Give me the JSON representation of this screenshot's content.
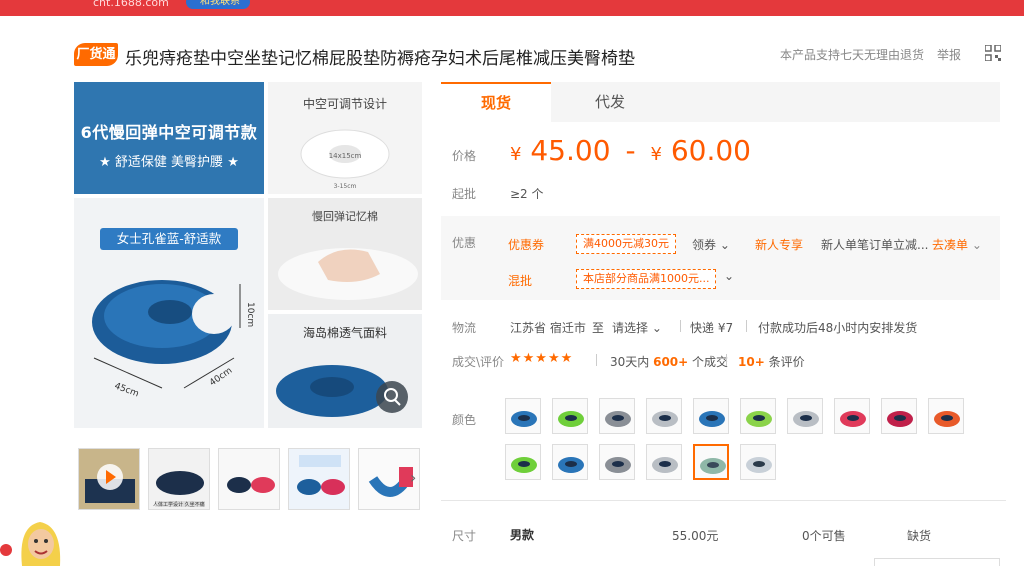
{
  "topbar": {
    "site": "cht.1688.com",
    "tag": "和我联系"
  },
  "header": {
    "badge": "厂货通",
    "title": "乐兜痔疮垫中空坐垫记忆棉屁股垫防褥疮孕妇术后尾椎减压美臀椅垫",
    "policy": "本产品支持七天无理由退货",
    "report": "举报"
  },
  "gallery": {
    "main_line1": "6代慢回弹中空可调节款",
    "main_line2": "★ 舒适保健 美臀护腰 ★",
    "hollow_caption": "中空可调节设计",
    "hollow_dim1": "14x15cm",
    "hollow_dim2": "3-15cm",
    "product_label": "女士孔雀蓝-舒适款",
    "dim_45": "45cm",
    "dim_40": "40cm",
    "dim_10": "10cm",
    "foam_caption": "慢回弹记忆棉",
    "mesh_caption": "海岛棉透气面料"
  },
  "thumbs": {
    "label2": "人体工学设计 久坐不痛",
    "label2_sub": "轻松久坐"
  },
  "tabs": [
    {
      "label": "现货"
    },
    {
      "label": "代发"
    }
  ],
  "price": {
    "label": "价格",
    "min": "45.00",
    "max": "60.00",
    "currency": "¥",
    "dash": "-"
  },
  "moq": {
    "label": "起批",
    "value": "≥2 个"
  },
  "promo": {
    "label": "优惠",
    "coupon_tag": "优惠券",
    "coupon_text": "满4000元减30元",
    "coupon_action": "领券",
    "new_tag": "新人专享",
    "new_text": "新人单笔订单立减...",
    "new_action": "去凑单",
    "mix_tag": "混批",
    "mix_text": "本店部分商品满1000元..."
  },
  "logistics": {
    "label": "物流",
    "origin": "江苏省 宿迁市",
    "to": "至",
    "dest": "请选择",
    "express": "快递 ¥7",
    "ship": "付款成功后48小时内安排发货"
  },
  "sales": {
    "label": "成交\\评价",
    "stars": "★★★★★",
    "days": "30天内",
    "count": "600+",
    "count_unit": "个成交",
    "reviews": "10+",
    "reviews_unit": "条评价"
  },
  "colors": {
    "label": "颜色",
    "selected_index": 14,
    "count": 16
  },
  "size": {
    "label": "尺寸",
    "name": "男款",
    "price": "55.00元",
    "stock": "0个可售",
    "status": "缺货"
  },
  "theme": {
    "accent": "#ff6a00",
    "brand_red": "#e4393c",
    "tile_blue": "#2f76b0"
  }
}
